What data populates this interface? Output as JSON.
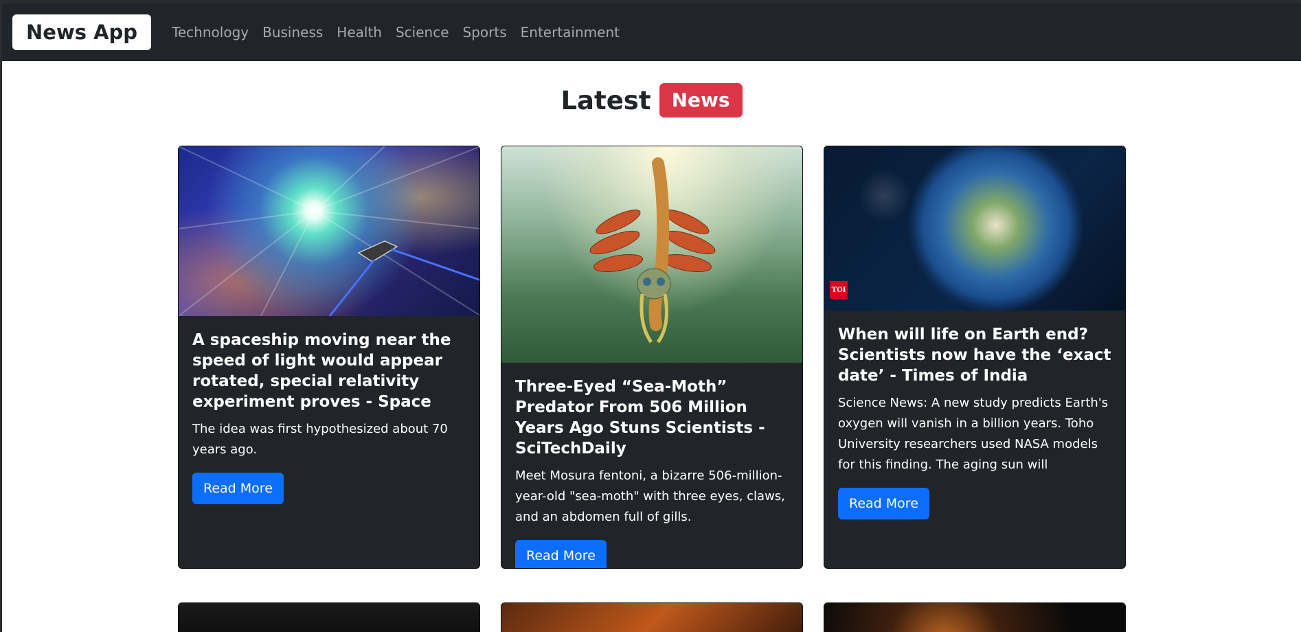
{
  "navbar": {
    "brand": "News App",
    "links": [
      "Technology",
      "Business",
      "Health",
      "Science",
      "Sports",
      "Entertainment"
    ]
  },
  "heading": {
    "text": "Latest",
    "badge": "News"
  },
  "cards": [
    {
      "title": "A spaceship moving near the speed of light would appear rotated, special relativity experiment proves - Space",
      "description": "The idea was first hypothesized about 70 years ago.",
      "button": "Read More"
    },
    {
      "title": "Three-Eyed “Sea-Moth” Predator From 506 Million Years Ago Stuns Scientists - SciTechDaily",
      "description": "Meet Mosura fentoni, a bizarre 506-million-year-old \"sea-moth\" with three eyes, claws, and an abdomen full of gills.",
      "button": "Read More"
    },
    {
      "title": "When will life on Earth end? Scientists now have the ‘exact date’ - Times of India",
      "description": "Science News: A new study predicts Earth's oxygen will vanish in a billion years. Toho University researchers used NASA models for this finding. The aging sun will",
      "button": "Read More",
      "source_logo": "TOI"
    }
  ],
  "colors": {
    "navbar_bg": "#212529",
    "card_bg": "#212529",
    "badge_bg": "#dc3545",
    "button_bg": "#0d6efd"
  }
}
